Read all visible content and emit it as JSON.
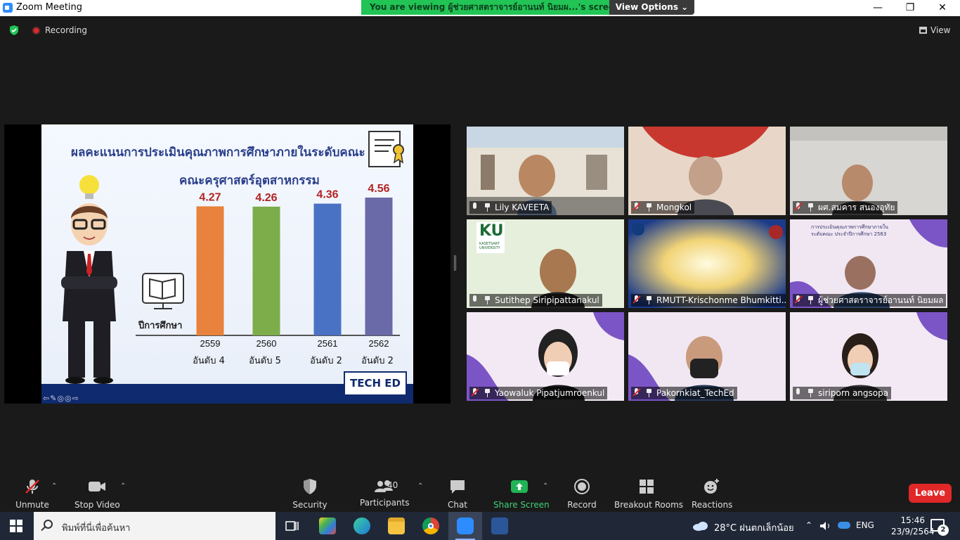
{
  "window": {
    "title": "Zoom Meeting",
    "viewing_banner": "You are viewing ผู้ช่วยศาสตราจารย์อานนท์ นิยมผ...'s screen",
    "view_options": "View Options ⌄",
    "minimize": "—",
    "restore": "❐",
    "close": "✕"
  },
  "topbar": {
    "recording": "Recording",
    "view": "View"
  },
  "slide": {
    "title": "ผลคะแนนการประเมินคุณภาพการศึกษาภายในระดับคณะ",
    "subtitle": "คณะครุศาสตร์อุตสาหกรรม",
    "axis_label": "ปีการศึกษา",
    "logo": "TECH ED",
    "nav": "⇦✎◎◎⇨"
  },
  "chart_data": {
    "type": "bar",
    "categories": [
      "2559",
      "2560",
      "2561",
      "2562"
    ],
    "values": [
      4.27,
      4.26,
      4.36,
      4.56
    ],
    "rank_labels": [
      "อันดับ 4",
      "อันดับ 5",
      "อันดับ 2",
      "อันดับ 2"
    ],
    "colors": [
      "#e8823c",
      "#7cad4a",
      "#4a72c4",
      "#6a6aa8"
    ],
    "title": "ผลคะแนนการประเมินคุณภาพการศึกษาภายในระดับคณะ",
    "xlabel": "ปีการศึกษา",
    "ylabel": "",
    "ylim": [
      0,
      4.56
    ]
  },
  "participants_gallery": [
    {
      "name": "Lily KAVEETA",
      "muted": false
    },
    {
      "name": "Mongkol",
      "muted": true
    },
    {
      "name": "ผศ.สมคาร  สนองอุทัย",
      "muted": true
    },
    {
      "name": "Sutithep Siripipattanakul",
      "muted": false
    },
    {
      "name": "RMUTT-Krischonme Bhumkitti...",
      "muted": true
    },
    {
      "name": "ผู้ช่วยศาสตราจารย์อานนท์ นิยมผล",
      "muted": true
    },
    {
      "name": "Yaowaluk Pipatjumroenkul",
      "muted": true
    },
    {
      "name": "Pakornkiat_TechEd",
      "muted": true
    },
    {
      "name": "siriporn angsopa",
      "muted": false
    }
  ],
  "tile_texts": {
    "ku_logo": "KU",
    "ku_sub": "KASETSART UNIVERSITY",
    "backdrop_line1": "การประเมินคุณภาพการศึกษาภายใน",
    "backdrop_line2": "ระดับคณะ ประจำปีการศึกษา 2563"
  },
  "toolbar": {
    "unmute": "Unmute",
    "stop_video": "Stop Video",
    "security": "Security",
    "participants": "Participants",
    "participant_count": "40",
    "chat": "Chat",
    "share_screen": "Share Screen",
    "record": "Record",
    "breakout_rooms": "Breakout Rooms",
    "reactions": "Reactions",
    "leave": "Leave",
    "caret": "⌃"
  },
  "taskbar": {
    "search_placeholder": "พิมพ์ที่นี่เพื่อค้นหา",
    "weather": "28°C  ฝนตกเล็กน้อย",
    "language": "ENG",
    "time": "15:46",
    "date": "23/9/2564",
    "notifications": "2"
  },
  "colors": {
    "accent_green": "#21c455",
    "leave_red": "#e02828",
    "share_green": "#21b356"
  }
}
